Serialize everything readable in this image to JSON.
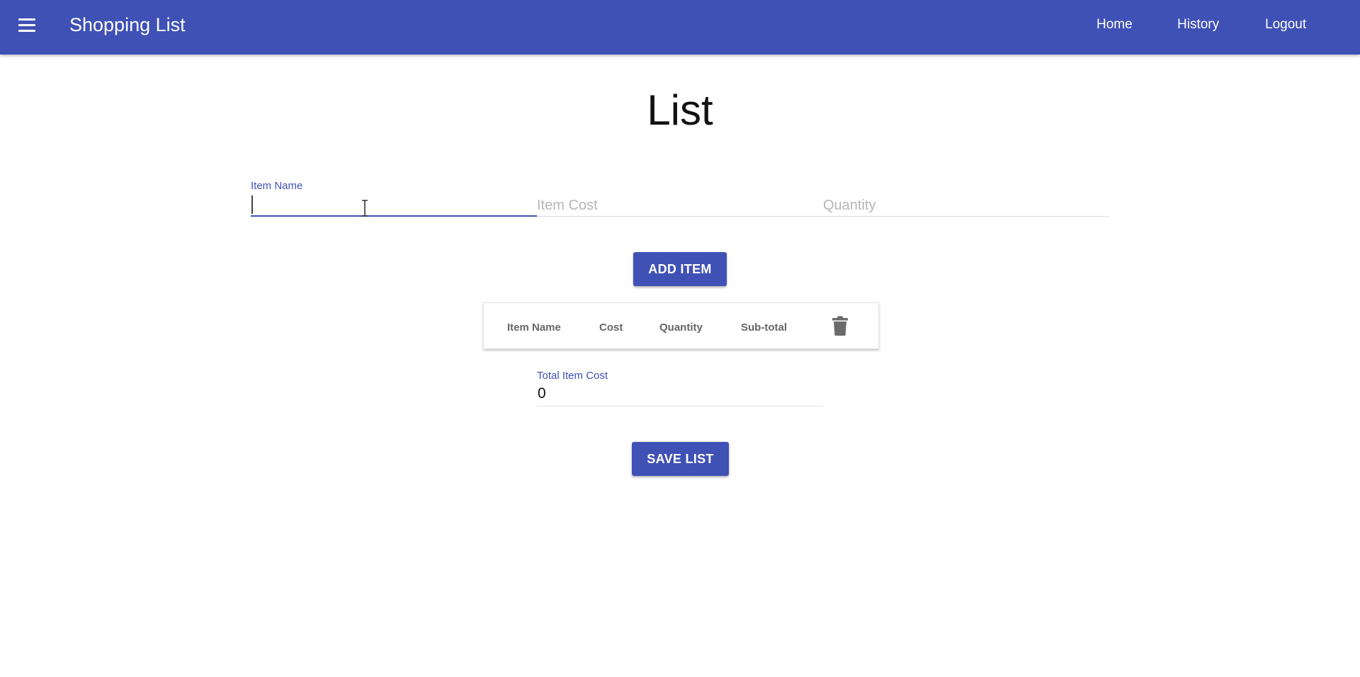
{
  "app": {
    "title": "Shopping List",
    "accent_color": "#3f51b5",
    "menu_icon": "menu-icon"
  },
  "nav": {
    "home": "Home",
    "history": "History",
    "logout": "Logout"
  },
  "page": {
    "title": "List"
  },
  "form": {
    "item_name": {
      "label": "Item Name",
      "value": ""
    },
    "item_cost": {
      "placeholder": "Item Cost",
      "value": ""
    },
    "quantity": {
      "placeholder": "Quantity",
      "value": ""
    },
    "add_button": "ADD ITEM"
  },
  "table": {
    "columns": [
      "Item Name",
      "Cost",
      "Quantity",
      "Sub-total"
    ],
    "delete_icon": "trash-icon",
    "rows": []
  },
  "total": {
    "label": "Total Item Cost",
    "value": "0"
  },
  "save_button": "SAVE LIST"
}
